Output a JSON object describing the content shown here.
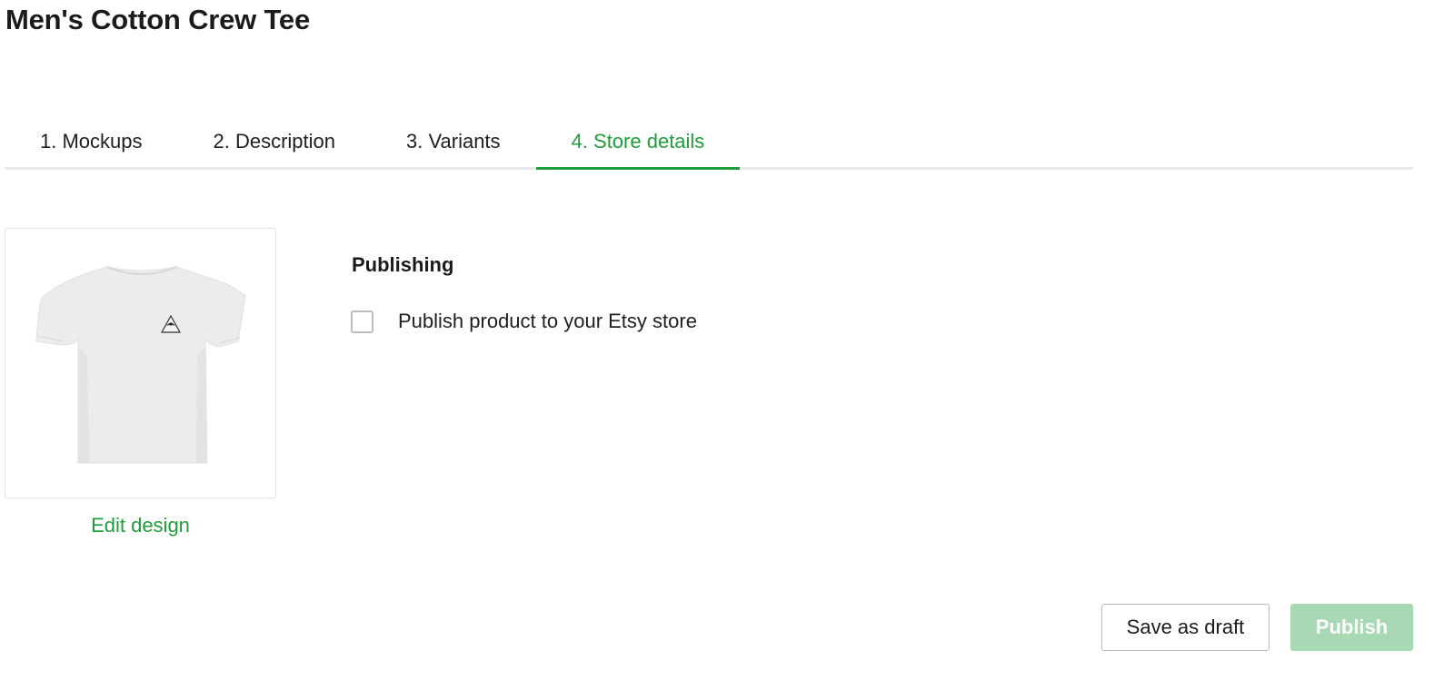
{
  "product": {
    "title": "Men's Cotton Crew Tee"
  },
  "tabs": [
    {
      "label": "1. Mockups",
      "active": false
    },
    {
      "label": "2. Description",
      "active": false
    },
    {
      "label": "3. Variants",
      "active": false
    },
    {
      "label": "4. Store details",
      "active": true
    }
  ],
  "mockup": {
    "image_icon": "tshirt-icon",
    "design_icon": "triangle-emblem-icon",
    "edit_label": "Edit design"
  },
  "publishing": {
    "heading": "Publishing",
    "checkbox_label": "Publish product to your Etsy store",
    "checked": false
  },
  "actions": {
    "save_draft_label": "Save as draft",
    "publish_label": "Publish"
  },
  "colors": {
    "accent": "#1f9d3a",
    "publish_disabled": "#a9d9b4",
    "tab_underline": "#e8e8e8"
  }
}
